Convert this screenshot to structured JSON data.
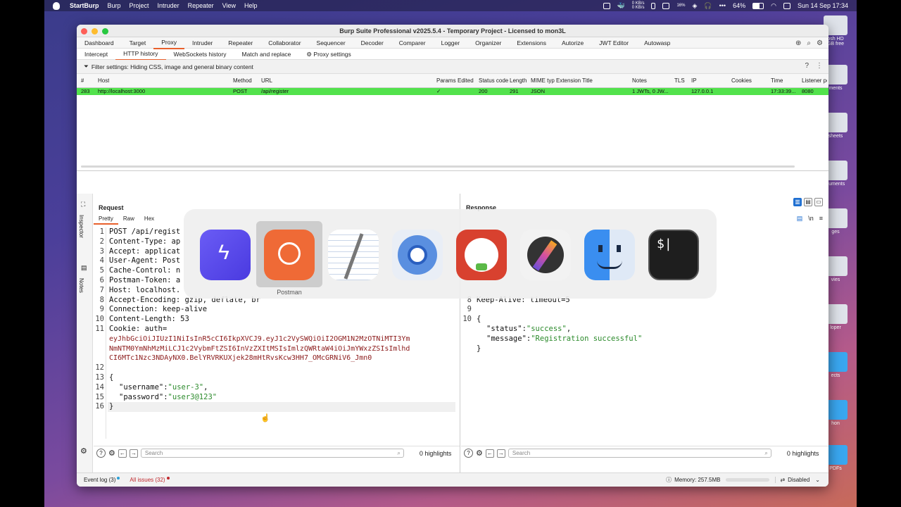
{
  "menubar": {
    "app": "StartBurp",
    "items": [
      "Burp",
      "Project",
      "Intruder",
      "Repeater",
      "View",
      "Help"
    ],
    "net_up": "0 KB/s",
    "net_down": "0 KB/s",
    "cpu": "16%",
    "battery": "64%",
    "datetime": "Sun 14 Sep 17:34"
  },
  "desktop": {
    "items": [
      "osh HD",
      "GB free",
      "ments",
      "sheets",
      "cuments",
      "ges",
      "vies",
      "loper",
      "ects",
      "hon",
      "PDFs"
    ],
    "sub": "ems"
  },
  "window": {
    "title": "Burp Suite Professional v2025.5.4 - Temporary Project - Licensed to mon3L"
  },
  "main_tabs": [
    "Dashboard",
    "Target",
    "Proxy",
    "Intruder",
    "Repeater",
    "Collaborator",
    "Sequencer",
    "Decoder",
    "Comparer",
    "Logger",
    "Organizer",
    "Extensions",
    "Autorize",
    "JWT Editor",
    "Autowasp"
  ],
  "proxy_tabs": [
    "Intercept",
    "HTTP history",
    "WebSockets history",
    "Match and replace",
    "Proxy settings"
  ],
  "filter": {
    "text": "Filter settings: Hiding CSS, image and general binary content"
  },
  "table": {
    "headers": [
      "#",
      "Host",
      "Method",
      "URL",
      "Params",
      "Edited",
      "Status code",
      "Length",
      "MIME type",
      "Extension",
      "Title",
      "Notes",
      "TLS",
      "IP",
      "Cookies",
      "Time",
      "Listener port"
    ],
    "row": {
      "num": "283",
      "host": "http://localhost:3000",
      "method": "POST",
      "url": "/api/register",
      "params": "✓",
      "status": "200",
      "length": "291",
      "mime": "JSON",
      "notes": "1 JWTs, 0 JW...",
      "ip": "127.0.0.1",
      "time": "17:33:39...",
      "port": "8080"
    }
  },
  "request": {
    "title": "Request",
    "tabs": [
      "Pretty",
      "Raw",
      "Hex"
    ],
    "lines": [
      {
        "n": "1",
        "t": "POST /api/regist"
      },
      {
        "n": "2",
        "t": "Content-Type: ap"
      },
      {
        "n": "3",
        "t": "Accept: applicat"
      },
      {
        "n": "4",
        "t": "User-Agent: Post"
      },
      {
        "n": "5",
        "t": "Cache-Control: n"
      },
      {
        "n": "6",
        "t": "Postman-Token: a"
      },
      {
        "n": "7",
        "t": "Host: localhost."
      },
      {
        "n": "8",
        "t": "Accept-Encoding: gzip, deflate, br"
      },
      {
        "n": "9",
        "t": "Connection: keep-alive"
      },
      {
        "n": "10",
        "t": "Content-Length: 53"
      },
      {
        "n": "11",
        "t": "Cookie: auth="
      }
    ],
    "cookie_lines": [
      "eyJhbGciOiJIUzI1NiIsInR5cCI6IkpXVCJ9.eyJ1c2VySWQiOiI2OGM1N2MzOTNiMTI3Ym",
      "NmNTM0YmNhMzMiLCJ1c2VybmFtZSI6InVzZXItMSIsImlzQWRtaW4iOiJmYWxzZSIsImlhd",
      "CI6MTc1Nzc3NDAyNX0.BelYRVRKUXjek28mHtRvsKcw3HH7_OMcGRNiV6_Jmn0"
    ],
    "body_open": "{",
    "username_key": "\"username\"",
    "username_val": "\"user-3\"",
    "password_key": "\"password\"",
    "password_val": "\"user3@123\"",
    "body_close": "}",
    "search_placeholder": "Search",
    "highlights": "0 highlights"
  },
  "response": {
    "title": "Response",
    "line8": "Keep-Alive: timeout=5",
    "open": "{",
    "status_key": "\"status\"",
    "status_val": "\"success\"",
    "message_key": "\"message\"",
    "message_val": "\"Registration successful\"",
    "close": "}",
    "search_placeholder": "Search",
    "highlights": "0 highlights"
  },
  "sidebar": {
    "inspector": "Inspector",
    "notes": "Notes"
  },
  "status": {
    "event_log": "Event log (3)",
    "issues": "All issues (32)",
    "memory": "Memory: 257.5MB",
    "disabled": "Disabled"
  },
  "switcher": {
    "selected_label": "Postman",
    "apps": [
      "Shortcuts",
      "Postman",
      "TextEdit",
      "Chromium",
      "DuckDuckGo",
      "Final Cut",
      "Finder",
      "Terminal"
    ]
  }
}
